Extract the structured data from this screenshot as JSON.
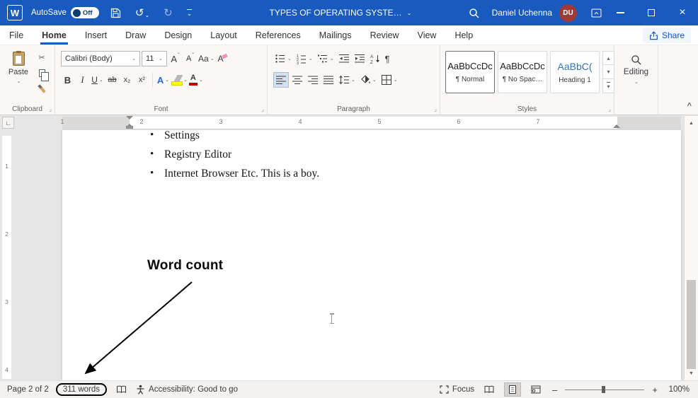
{
  "icons": {
    "chevron_down": "⌄",
    "collapse_ribbon": "^",
    "undo": "↺",
    "redo": "↻",
    "scissors": "✂",
    "pilcrow": "¶",
    "close": "×",
    "caret_up": "ˆ",
    "caron_down": "ˇ",
    "gallery_up": "▴",
    "gallery_down": "▾",
    "gallery_more": "▾",
    "scroll_up": "▲",
    "scroll_down": "▼",
    "zoom_out": "–",
    "zoom_in": "+",
    "dialog_launcher": "⌟",
    "tab_selector": "∟"
  },
  "titlebar": {
    "autosave_label": "AutoSave",
    "autosave_state": "Off",
    "doc_title": "TYPES OF OPERATING SYSTE…",
    "user_name": "Daniel Uchenna",
    "user_initials": "DU"
  },
  "tabs": {
    "items": [
      "File",
      "Home",
      "Insert",
      "Draw",
      "Design",
      "Layout",
      "References",
      "Mailings",
      "Review",
      "View",
      "Help"
    ],
    "share_label": "Share"
  },
  "ribbon": {
    "clipboard": {
      "paste_label": "Paste",
      "group_label": "Clipboard"
    },
    "font": {
      "family": "Calibri (Body)",
      "size": "11",
      "bold": "B",
      "italic": "I",
      "underline": "U",
      "strikethrough": "ab",
      "subscript": "x₂",
      "superscript": "x²",
      "change_case": "Aa",
      "grow_font": "A",
      "shrink_font": "A",
      "clear_format": "A",
      "text_effects": "A",
      "font_color": "A",
      "group_label": "Font"
    },
    "paragraph": {
      "sort_a": "A",
      "sort_z": "Z",
      "group_label": "Paragraph"
    },
    "styles": {
      "group_label": "Styles",
      "items": [
        {
          "preview": "AaBbCcDc",
          "name": "¶ Normal"
        },
        {
          "preview": "AaBbCcDc",
          "name": "¶ No Spac…"
        },
        {
          "preview": "AaBbC(",
          "name": "Heading 1"
        }
      ]
    },
    "editing": {
      "label": "Editing"
    }
  },
  "ruler": {
    "h_numbers": [
      "1",
      "2",
      "3",
      "4",
      "5",
      "6",
      "7"
    ],
    "v_numbers": [
      "1",
      "2",
      "3",
      "4"
    ]
  },
  "document": {
    "bullets": [
      "Settings",
      "Registry Editor",
      "Internet Browser Etc. This is a boy."
    ],
    "annotation_label": "Word count"
  },
  "statusbar": {
    "page_info": "Page 2 of 2",
    "word_count": "311 words",
    "accessibility": "Accessibility: Good to go",
    "focus_label": "Focus",
    "zoom_level": "100%"
  },
  "colors": {
    "titlebar_blue": "#185abd",
    "accent_blue": "#185abd",
    "heading_style_blue": "#2e74b5",
    "highlight_yellow": "#ffff00",
    "font_color_red": "#c00000",
    "avatar_maroon": "#9e3a38"
  }
}
